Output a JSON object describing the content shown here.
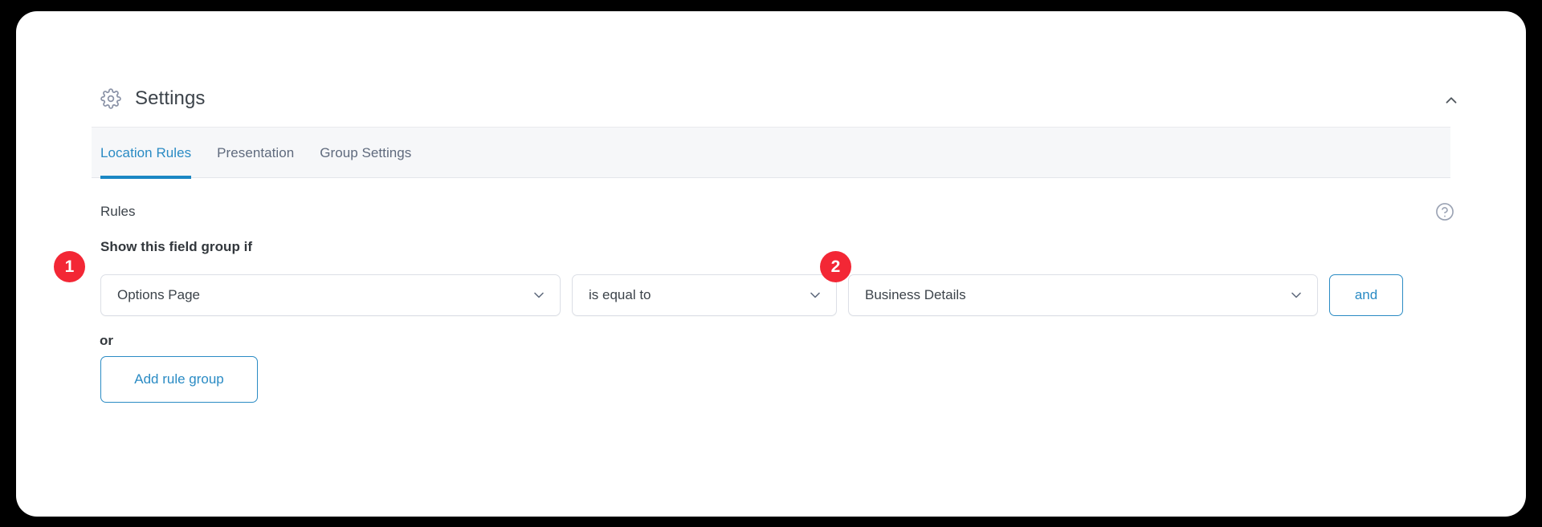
{
  "panel": {
    "title": "Settings",
    "gear_icon": "gear-icon",
    "collapse_icon": "chevron-up-icon"
  },
  "tabs": [
    {
      "label": "Location Rules",
      "active": true
    },
    {
      "label": "Presentation",
      "active": false
    },
    {
      "label": "Group Settings",
      "active": false
    }
  ],
  "rules": {
    "section_label": "Rules",
    "help_icon": "question-mark-circle-icon",
    "condition_label": "Show this field group if",
    "row": {
      "param": "Options Page",
      "operator": "is equal to",
      "value": "Business Details",
      "chevron_icon": "chevron-down-icon",
      "and_label": "and"
    },
    "or_label": "or",
    "add_rule_group_label": "Add rule group"
  },
  "annotations": [
    {
      "number": "1"
    },
    {
      "number": "2"
    }
  ],
  "colors": {
    "accent_blue": "#2a8bc4",
    "tab_underline": "#1b87c4",
    "badge_red": "#f32735",
    "text_dark": "#3c434a",
    "text_muted": "#5f6a7d",
    "tabbar_bg": "#f6f7f9",
    "backdrop": "#000000"
  }
}
